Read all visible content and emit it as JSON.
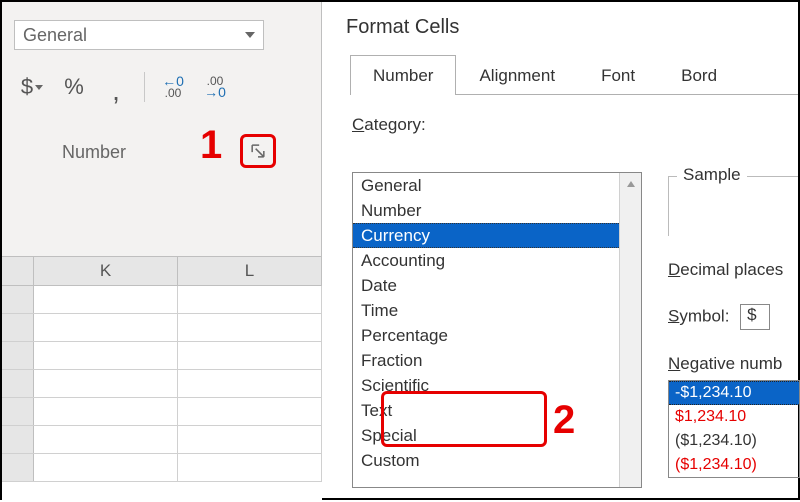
{
  "ribbon": {
    "combo_value": "General",
    "accounting_btn": "$",
    "percent_btn": "%",
    "thousands_btn": ",",
    "increase_decimal_top": "←0",
    "increase_decimal_bot": ".00",
    "decrease_decimal_top": ".00",
    "decrease_decimal_bot": "→0",
    "group_label": "Number"
  },
  "callouts": {
    "one": "1",
    "two": "2"
  },
  "sheet": {
    "col1": "K",
    "col2": "L"
  },
  "dialog": {
    "title": "Format Cells",
    "tabs": [
      "Number",
      "Alignment",
      "Font",
      "Bord"
    ],
    "active_tab": 0,
    "category_label_pre": "C",
    "category_label_rest": "ategory:",
    "categories": [
      "General",
      "Number",
      "Currency",
      "Accounting",
      "Date",
      "Time",
      "Percentage",
      "Fraction",
      "Scientific",
      "Text",
      "Special",
      "Custom"
    ],
    "selected_category": 2,
    "sample_label": "Sample",
    "decimal_label_pre": "D",
    "decimal_label_rest": "ecimal places",
    "symbol_label_pre": "S",
    "symbol_label_rest": "ymbol:",
    "symbol_value": "$",
    "negative_label_pre": "N",
    "negative_label_rest": "egative numb",
    "negative_items": [
      "-$1,234.10",
      "$1,234.10",
      "($1,234.10)",
      "($1,234.10)"
    ],
    "negative_red_indices": [
      1,
      3
    ],
    "negative_selected": 0
  }
}
